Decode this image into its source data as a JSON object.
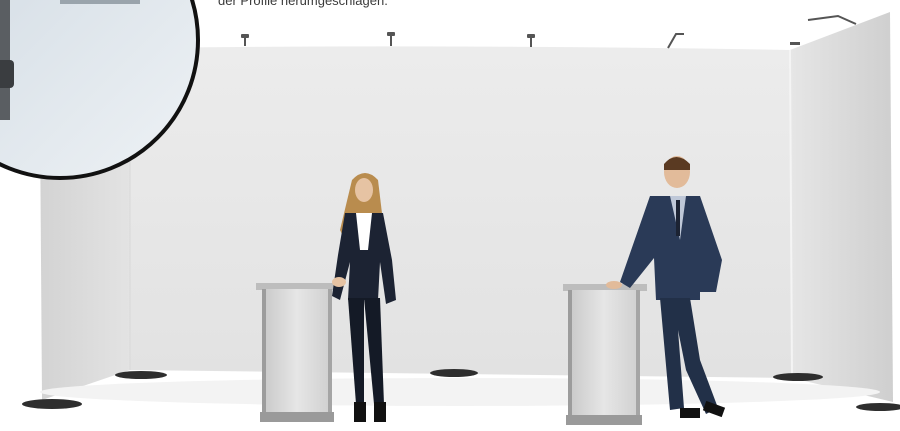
{
  "caption": {
    "text": "der Profile herumgeschlagen."
  },
  "colors": {
    "background": "#ffffff",
    "wall": "#e6e6e6",
    "wall_shadow": "#d2d2d2",
    "counter": "#d9d9d9",
    "suit_dark": "#1c2333",
    "suit_blue": "#2a3a57",
    "hair": "#b88a4a",
    "base": "#333333"
  },
  "icons": [
    "lamp-icon",
    "magnifier-circle-icon"
  ]
}
